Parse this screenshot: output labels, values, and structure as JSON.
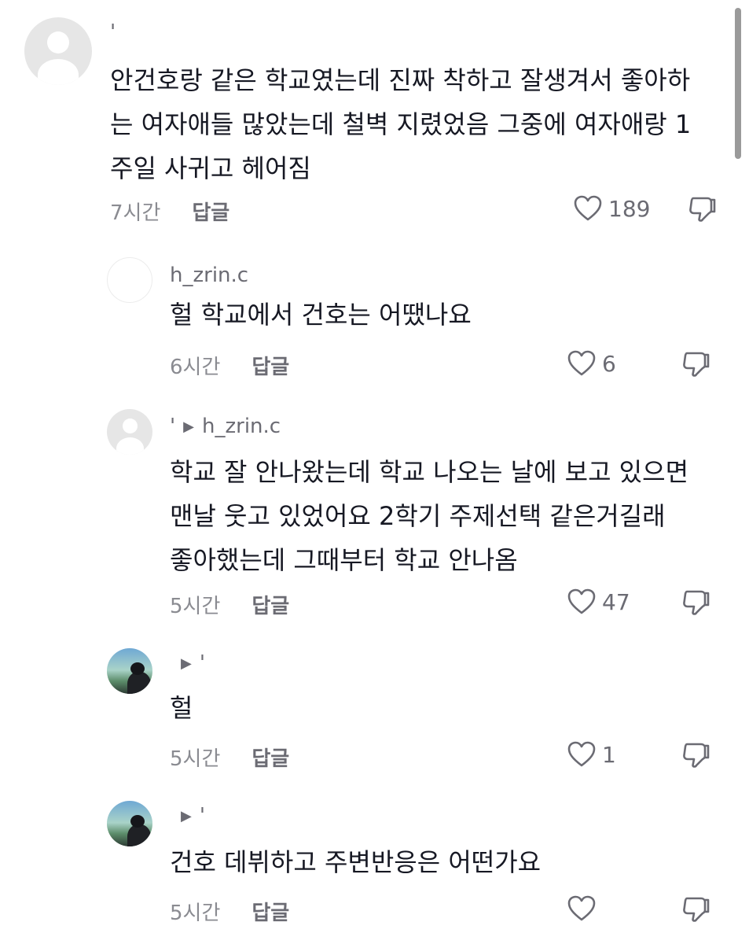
{
  "comments": [
    {
      "username": "'",
      "lines": [
        "안건호랑 같은 학교였는데 진짜 착하고 잘생겨서 좋아하",
        "는 여자애들 많았는데 철벽 지렸었음 그중에 여자애랑 1",
        "주일 사귀고 헤어짐"
      ],
      "time": "7시간",
      "reply_label": "답글",
      "likes": "189"
    },
    {
      "username": "h_zrin.c",
      "lines": [
        "헐 학교에서 건호는 어땠나요"
      ],
      "time": "6시간",
      "reply_label": "답글",
      "likes": "6"
    },
    {
      "username": "'",
      "arrow": "▶",
      "reply_to": "h_zrin.c",
      "lines": [
        "학교 잘 안나왔는데 학교 나오는 날에 보고 있으면",
        "맨날 웃고 있었어요 2학기 주제선택 같은거길래",
        "좋아했는데 그때부터 학교 안나옴"
      ],
      "time": "5시간",
      "reply_label": "답글",
      "likes": "47"
    },
    {
      "arrow": "▶",
      "reply_to": "'",
      "lines": [
        "헐"
      ],
      "time": "5시간",
      "reply_label": "답글",
      "likes": "1"
    },
    {
      "arrow": "▶",
      "reply_to": "'",
      "lines": [
        "건호 데뷔하고 주변반응은 어떤가요"
      ],
      "time": "5시간",
      "reply_label": "답글",
      "likes": ""
    }
  ],
  "icons": {
    "like": "heart-outline-icon",
    "dislike": "thumbs-down-icon"
  }
}
